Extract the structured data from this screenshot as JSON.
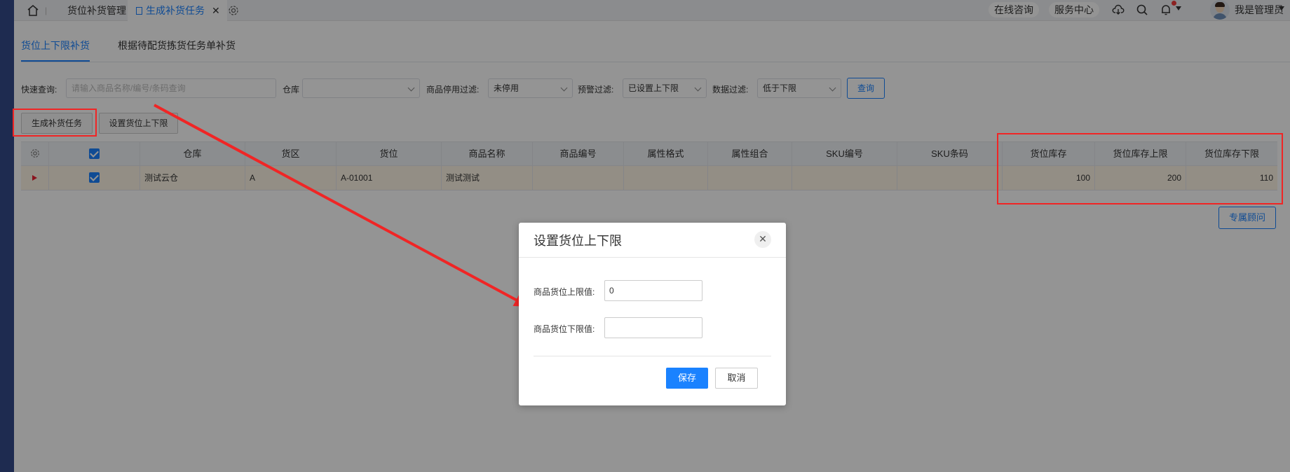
{
  "topbar": {
    "tabs": [
      {
        "label": "货位补货管理"
      },
      {
        "label": "生成补货任务",
        "close": "✕"
      }
    ],
    "right": {
      "online_consult": "在线咨询",
      "service_center": "服务中心",
      "user_name": "我是管理员"
    },
    "icons": [
      "home-icon",
      "settings-icon",
      "cloud-download-icon",
      "search-icon",
      "bell-icon",
      "avatar"
    ]
  },
  "subtabs": [
    {
      "label": "货位上下限补货",
      "active": true
    },
    {
      "label": "根据待配货拣货任务单补货",
      "active": false
    }
  ],
  "filters": {
    "quick_label": "快速查询:",
    "quick_placeholder": "请输入商品名称/编号/条码查询",
    "warehouse_label": "仓库",
    "warehouse_value": "",
    "stop_label": "商品停用过滤:",
    "stop_value": "未停用",
    "warn_label": "预警过滤:",
    "warn_value": "已设置上下限",
    "data_label": "数据过滤:",
    "data_value": "低于下限",
    "query_button": "查询"
  },
  "actions": {
    "generate": "生成补货任务",
    "set_limits": "设置货位上下限"
  },
  "table": {
    "headers": [
      "仓库",
      "货区",
      "货位",
      "商品名称",
      "商品编号",
      "属性格式",
      "属性组合",
      "SKU编号",
      "SKU条码",
      "货位库存",
      "货位库存上限",
      "货位库存下限"
    ],
    "rows": [
      {
        "warehouse": "测试云仓",
        "area": "A",
        "location": "A-01001",
        "product_name": "测试测试",
        "product_code": "",
        "attr_format": "",
        "attr_combo": "",
        "sku_code": "",
        "sku_barcode": "",
        "stock": "100",
        "upper": "200",
        "lower": "110"
      }
    ]
  },
  "consultant_button": "专属顾问",
  "dialog": {
    "title": "设置货位上下限",
    "close": "✕",
    "upper_label": "商品货位上限值:",
    "upper_value": "0",
    "lower_label": "商品货位下限值:",
    "lower_value": "",
    "save": "保存",
    "cancel": "取消"
  },
  "annotation_color": "#f02525",
  "accent_color": "#1a82ff"
}
